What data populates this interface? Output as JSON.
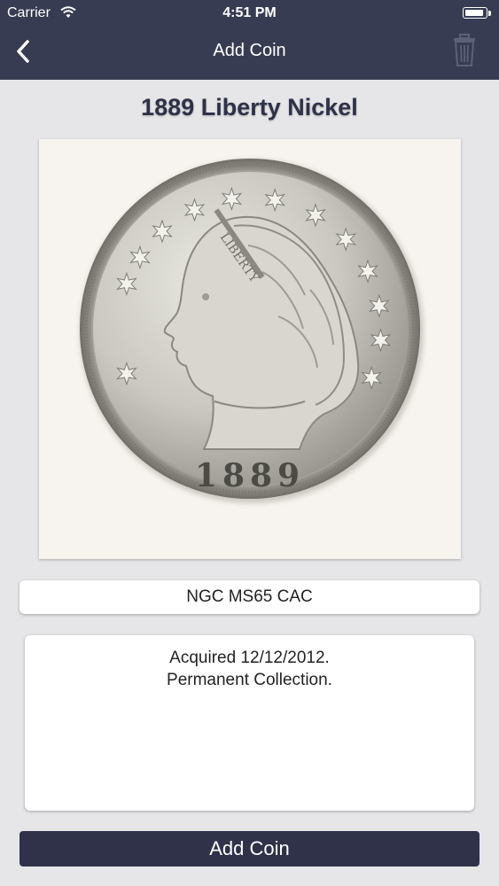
{
  "status_bar": {
    "carrier": "Carrier",
    "time": "4:51 PM",
    "battery_level": 0.95
  },
  "nav": {
    "title": "Add Coin",
    "back_icon": "chevron-left-icon",
    "trash_icon": "trash-icon"
  },
  "coin": {
    "title": "1889 Liberty Nickel",
    "image": {
      "date_text": "1889",
      "legend_text": "LIBERTY"
    },
    "grade": "NGC MS65 CAC",
    "notes": {
      "line1": "Acquired 12/12/2012.",
      "line2": "Permanent Collection."
    }
  },
  "actions": {
    "add_coin_label": "Add Coin"
  },
  "colors": {
    "header_bg": "#383c52",
    "button_bg": "#2f3249",
    "page_bg": "#e6e6e8",
    "title_text": "#2e3148"
  }
}
